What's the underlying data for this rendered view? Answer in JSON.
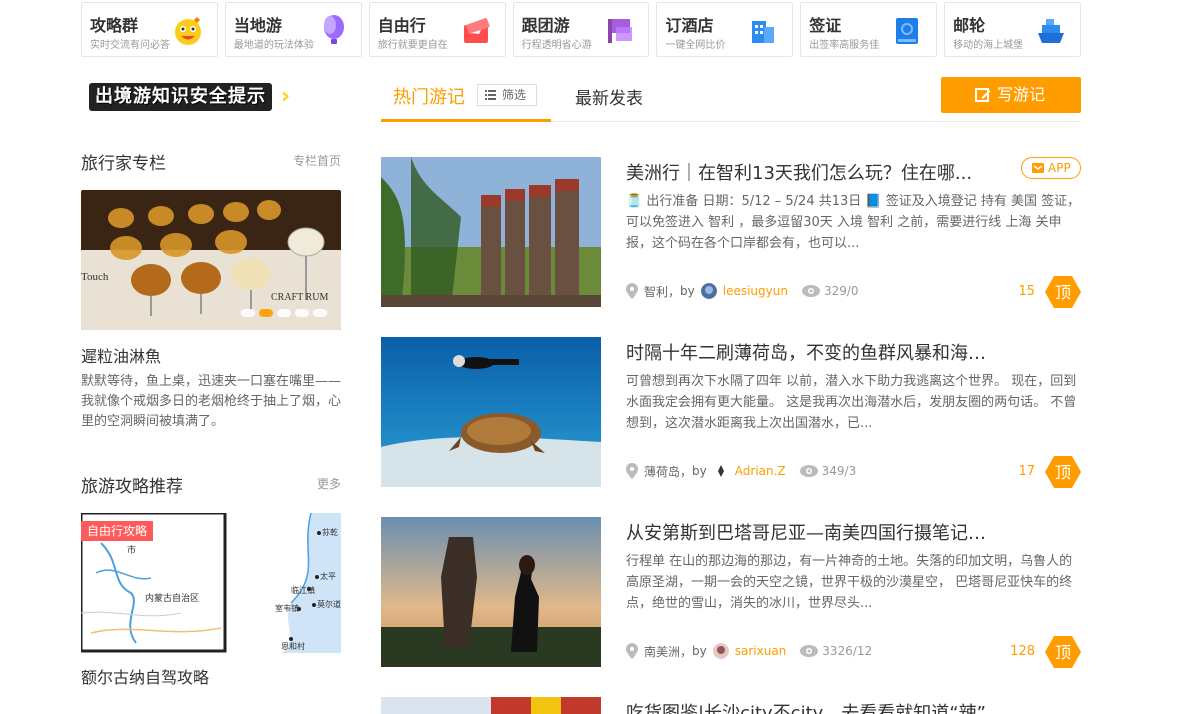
{
  "nav": [
    {
      "title": "攻略群",
      "sub": "实时交流有问必答",
      "icon": "emoji-face-icon"
    },
    {
      "title": "当地游",
      "sub": "最地道的玩法体验",
      "icon": "balloon-icon"
    },
    {
      "title": "自由行",
      "sub": "旅行就要更自在",
      "icon": "plane-ticket-icon"
    },
    {
      "title": "跟团游",
      "sub": "行程透明省心游",
      "icon": "flag-icon"
    },
    {
      "title": "订酒店",
      "sub": "一键全网比价",
      "icon": "hotel-icon"
    },
    {
      "title": "签证",
      "sub": "出签率高服务佳",
      "icon": "passport-icon"
    },
    {
      "title": "邮轮",
      "sub": "移动的海上城堡",
      "icon": "ship-icon"
    }
  ],
  "safety_banner": "出境游知识安全提示",
  "columnist": {
    "title": "旅行家专栏",
    "link": "专栏首页",
    "article_title": "遲粒油淋魚",
    "article_desc": "默默等待，鱼上桌，迅速夹一口塞在嘴里——我就像个戒烟多日的老烟枪终于抽上了烟，心里的空洞瞬间被填满了。"
  },
  "strategy": {
    "title": "旅游攻略推荐",
    "link": "更多",
    "tag": "自由行攻略",
    "article_title": "额尔古纳自驾攻略",
    "map_labels": [
      "市",
      "内蒙古自治区",
      "荪乾",
      "太平",
      "临江镇",
      "莫尔道嘎镇",
      "室韦镇",
      "恩和村"
    ]
  },
  "tabs": {
    "hot": "热门游记",
    "filter": "筛选",
    "new": "最新发表",
    "write": "写游记"
  },
  "posts": [
    {
      "title": "美洲行｜在智利13天我们怎么玩？住在哪...",
      "badge": "APP",
      "desc": "🫙 出行准备 日期：5/12 – 5/24 共13日 📘 签证及入境登记 持有 美国 签证，可以免签进入 智利 ，最多逗留30天 入境 智利 之前，需要进行线 上海 关申报，这个码在各个口岸都会有，也可以...",
      "location": "智利",
      "by": "by",
      "user": "leesiugyun",
      "views": "329/0",
      "likes": "15",
      "top": "顶"
    },
    {
      "title": "时隔十年二刷薄荷岛，不变的鱼群风暴和海龟漫步...",
      "desc": "可曾想到再次下水隔了四年 以前，潜入水下助力我逃离这个世界。 现在，回到水面我定会拥有更大能量。 这是我再次出海潜水后，发朋友圈的两句话。 不曾想到，这次潜水距离我上次出国潜水，已...",
      "location": "薄荷岛",
      "by": "by",
      "user": "Adrian.Z",
      "views": "349/3",
      "likes": "17",
      "top": "顶"
    },
    {
      "title": "从安第斯到巴塔哥尼亚—南美四国行摄笔记（秘鲁...",
      "desc": "行程单 在山的那边海的那边，有一片神奇的土地。失落的印加文明，乌鲁人的高原圣湖，一期一会的天空之镜，世界干极的沙漠星空， 巴塔哥尼亚快车的终点，绝世的雪山，消失的冰川，世界尽头...",
      "location": "南美洲",
      "by": "by",
      "user": "sarixuan",
      "views": "3326/12",
      "likes": "128",
      "top": "顶"
    },
    {
      "title": "吃货图鉴|长沙city不city，去看看就知道“辣”",
      "desc": "",
      "location": "",
      "by": "",
      "user": "",
      "views": "",
      "likes": "",
      "top": ""
    }
  ],
  "colors": {
    "accent": "#ff9d00",
    "tag": "#ff5a5a"
  }
}
